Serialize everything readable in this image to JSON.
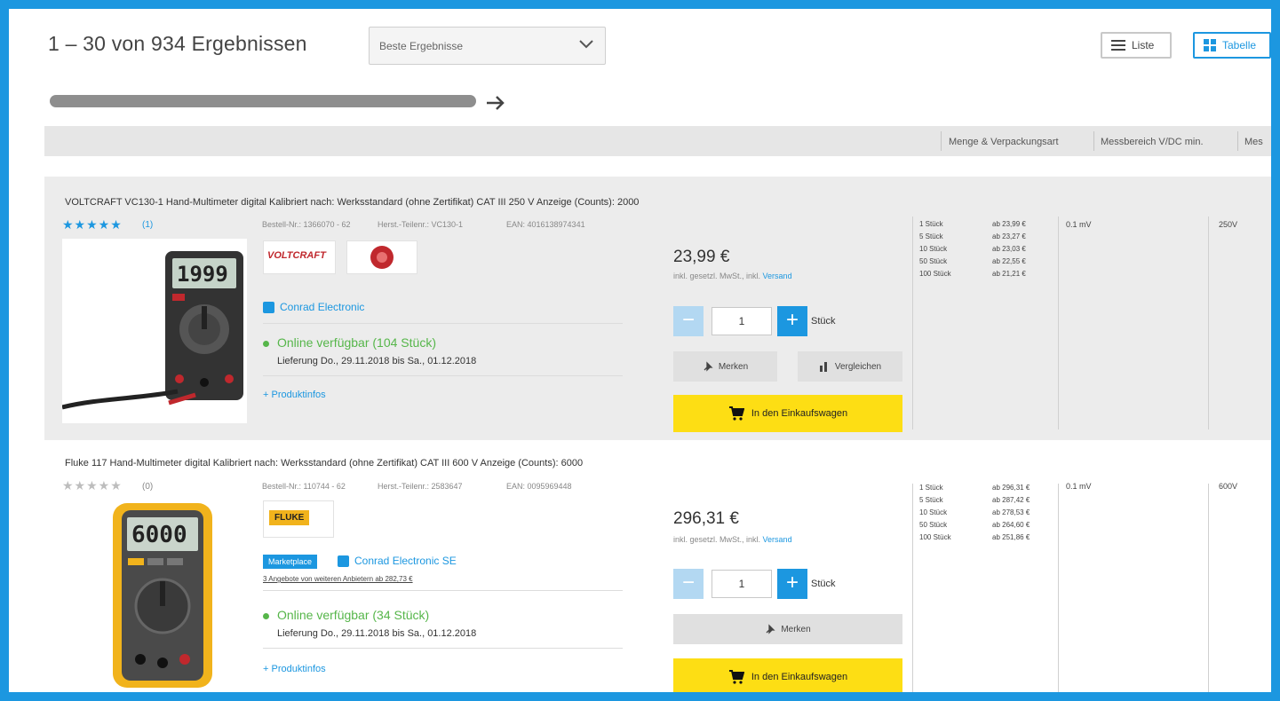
{
  "header": {
    "results": "1 – 30 von 934 Ergebnissen",
    "sort_value": "Beste Ergebnisse",
    "view_list": "Liste",
    "view_table": "Tabelle"
  },
  "columns": [
    "Menge & Verpackungsart",
    "Messbereich V/DC min.",
    "Mes"
  ],
  "products": [
    {
      "title": "VOLTCRAFT VC130-1 Hand-Multimeter digital Kalibriert nach: Werksstandard (ohne Zertifikat) CAT III 250 V Anzeige (Counts): 2000",
      "rating_count": "(1)",
      "bestell_nr": "Bestell-Nr.: 1366070 - 62",
      "herst_nr": "Herst.-Teilenr.: VC130-1",
      "ean": "EAN: 4016138974341",
      "brand": "VOLTCRAFT",
      "seller": "Conrad Electronic",
      "availability": "Online verfügbar (104 Stück)",
      "delivery": "Lieferung Do., 29.11.2018 bis Sa., 01.12.2018",
      "more": "+ Produktinfos",
      "price": "23,99 €",
      "vat_prefix": "inkl. gesetzl. MwSt., inkl.",
      "vat_link": "Versand",
      "qty": "1",
      "unit": "Stück",
      "note_btn": "Merken",
      "compare_btn": "Vergleichen",
      "cart_btn": "In den Einkaufswagen",
      "tiers": [
        {
          "q": "1 Stück",
          "p": "ab 23,99 €"
        },
        {
          "q": "5 Stück",
          "p": "ab 23,27 €"
        },
        {
          "q": "10 Stück",
          "p": "ab 23,03 €"
        },
        {
          "q": "50 Stück",
          "p": "ab 22,55 €"
        },
        {
          "q": "100 Stück",
          "p": "ab 21,21 €"
        }
      ],
      "spec1": "0.1 mV",
      "spec2": "250V"
    },
    {
      "title": "Fluke 117 Hand-Multimeter digital Kalibriert nach: Werksstandard (ohne Zertifikat) CAT III 600 V Anzeige (Counts): 6000",
      "rating_count": "(0)",
      "bestell_nr": "Bestell-Nr.: 110744 - 62",
      "herst_nr": "Herst.-Teilenr.: 2583647",
      "ean": "EAN: 0095969448",
      "brand": "FLUKE",
      "badge": "Marketplace",
      "seller": "Conrad Electronic SE",
      "offers": "3 Angebote von weiteren Anbietern ab 282,73 €",
      "availability": "Online verfügbar (34 Stück)",
      "delivery": "Lieferung Do., 29.11.2018 bis Sa., 01.12.2018",
      "more": "+ Produktinfos",
      "price": "296,31 €",
      "vat_prefix": "inkl. gesetzl. MwSt., inkl.",
      "vat_link": "Versand",
      "qty": "1",
      "unit": "Stück",
      "note_btn": "Merken",
      "cart_btn": "In den Einkaufswagen",
      "tiers": [
        {
          "q": "1 Stück",
          "p": "ab 296,31 €"
        },
        {
          "q": "5 Stück",
          "p": "ab 287,42 €"
        },
        {
          "q": "10 Stück",
          "p": "ab 278,53 €"
        },
        {
          "q": "50 Stück",
          "p": "ab 264,60 €"
        },
        {
          "q": "100 Stück",
          "p": "ab 251,86 €"
        }
      ],
      "spec1": "0.1 mV",
      "spec2": "600V"
    }
  ],
  "colors": {
    "accent": "#1c97e0",
    "cart": "#fdde14",
    "available": "#56b64a"
  }
}
